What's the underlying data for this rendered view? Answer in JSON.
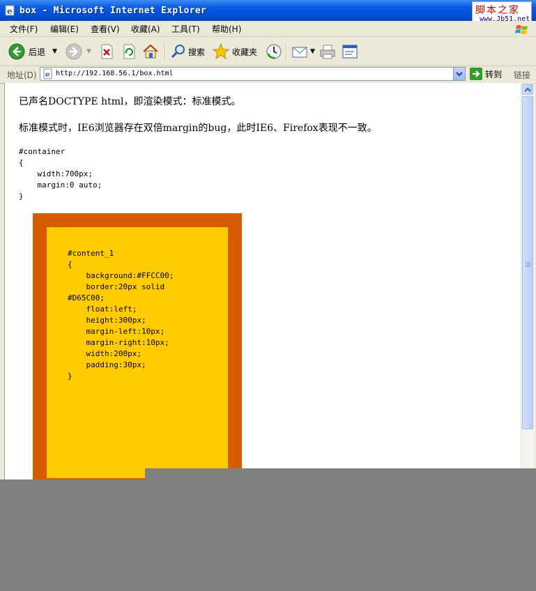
{
  "window": {
    "title": "box - Microsoft Internet Explorer",
    "watermark_title": "脚本之家",
    "watermark_url": "www.Jb51.net"
  },
  "menu": [
    "文件(F)",
    "编辑(E)",
    "查看(V)",
    "收藏(A)",
    "工具(T)",
    "帮助(H)"
  ],
  "toolbar": {
    "back_label": "后退",
    "search_label": "搜索",
    "favorites_label": "收藏夹"
  },
  "address": {
    "label": "地址(D)",
    "url": "http://192.168.56.1/box.html",
    "go_label": "转到",
    "links_label": "链接"
  },
  "page": {
    "line1": "已声名DOCTYPE html，即渲染模式：标准模式。",
    "line2": "标准模式时，IE6浏览器存在双倍margin的bug，此时IE6、Firefox表现不一致。",
    "container_code": "#container\n{\n    width:700px;\n    margin:0 auto;\n}",
    "content_code": "#content_1\n{\n    background:#FFCC00;\n    border:20px solid\n#D65C00;\n    float:left;\n    height:300px;\n    margin-left:10px;\n    margin-right:10px;\n    width:200px;\n    padding:30px;\n}"
  },
  "colors": {
    "box_background": "#FFCC00",
    "box_border": "#D65C00",
    "titlebar": "#0A5BE0"
  }
}
